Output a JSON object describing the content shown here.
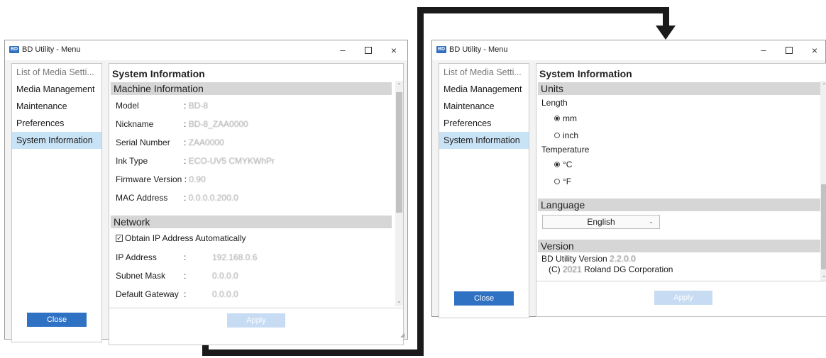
{
  "app": {
    "title": "BD Utility - Menu",
    "icon_text": "BD",
    "window_controls": {
      "minimize": "–",
      "maximize": "□",
      "close": "×"
    }
  },
  "colors": {
    "selected_item": "#c9e3f6",
    "close_button": "#2f72c4",
    "apply_disabled": "#c7dcf3",
    "section_header": "#d6d6d6",
    "connector": "#1a1a1a"
  },
  "sidebar": {
    "items": [
      {
        "label": "List of Media Setti..."
      },
      {
        "label": "Media Management"
      },
      {
        "label": "Maintenance"
      },
      {
        "label": "Preferences"
      },
      {
        "label": "System Information"
      }
    ]
  },
  "buttons": {
    "close": "Close",
    "apply": "Apply"
  },
  "left": {
    "page_title": "System Information",
    "machine": {
      "header": "Machine Information",
      "rows": [
        {
          "label": "Model",
          "sep": ":",
          "value": "BD-8"
        },
        {
          "label": "Nickname",
          "sep": ":",
          "value": "BD-8_ZAA0000"
        },
        {
          "label": "Serial Number",
          "sep": ":",
          "value": "ZAA0000"
        },
        {
          "label": "Ink Type",
          "sep": ":",
          "value": "ECO-UV5 CMYKWhPr"
        },
        {
          "label": "Firmware Version",
          "sep": ":",
          "value": "0.90"
        },
        {
          "label": "MAC Address",
          "sep": ":",
          "value": "0.0.0.0.200.0"
        }
      ]
    },
    "network": {
      "header": "Network",
      "obtain_ip_label": "Obtain IP Address Automatically",
      "obtain_ip_checked": true,
      "rows": [
        {
          "label": "IP Address",
          "sep": ":",
          "value": "192.168.0.6"
        },
        {
          "label": "Subnet Mask",
          "sep": ":",
          "value": "0.0.0.0"
        },
        {
          "label": "Default Gateway",
          "sep": ":",
          "value": "0.0.0.0"
        }
      ]
    }
  },
  "right": {
    "page_title": "System Information",
    "units": {
      "header": "Units",
      "length_label": "Length",
      "length_options": [
        "mm",
        "inch"
      ],
      "length_selected": "mm",
      "temperature_label": "Temperature",
      "temperature_options": [
        "°C",
        "°F"
      ],
      "temperature_selected": "°C"
    },
    "language": {
      "header": "Language",
      "selected": "English"
    },
    "version": {
      "header": "Version",
      "version_prefix": "BD Utility Version",
      "version_number": "2.2.0.0",
      "copyright_prefix": "(C)",
      "copyright_year": "2021",
      "copyright_owner": "Roland DG Corporation"
    }
  }
}
